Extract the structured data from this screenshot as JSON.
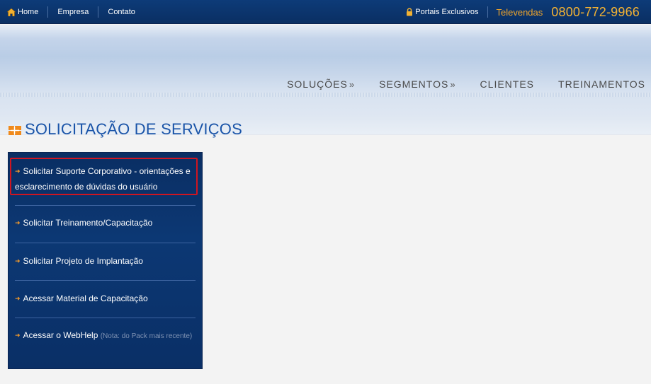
{
  "topbar": {
    "links": [
      {
        "label": "Home",
        "icon": "home-icon"
      },
      {
        "label": "Empresa"
      },
      {
        "label": "Contato"
      }
    ],
    "portais_label": "Portais Exclusivos",
    "televendas_label": "Televendas",
    "phone": "0800-772-9966"
  },
  "mainnav": {
    "items": [
      {
        "label": "SOLUÇÕES",
        "arrow": "»"
      },
      {
        "label": "SEGMENTOS",
        "arrow": "»"
      },
      {
        "label": "CLIENTES",
        "arrow": ""
      },
      {
        "label": "TREINAMENTOS",
        "arrow": ""
      }
    ]
  },
  "page": {
    "title": "SOLICITAÇÃO DE SERVIÇOS"
  },
  "services": {
    "items": [
      {
        "label": "Solicitar Suporte Corporativo - orientações e esclarecimento de dúvidas do usuário",
        "highlighted": true
      },
      {
        "label": "Solicitar Treinamento/Capacitação"
      },
      {
        "label": "Solicitar Projeto de Implantação"
      },
      {
        "label": "Acessar Material de Capacitação"
      },
      {
        "label": "Acessar o WebHelp",
        "note": "(Nota: do Pack mais recente)"
      }
    ],
    "bullet": "➜"
  },
  "colors": {
    "topbar_bg": "#0d3b78",
    "accent_orange": "#f4b233",
    "title_blue": "#1a54a8",
    "panel_bg": "#0c3874",
    "highlight_red": "#d01520"
  }
}
